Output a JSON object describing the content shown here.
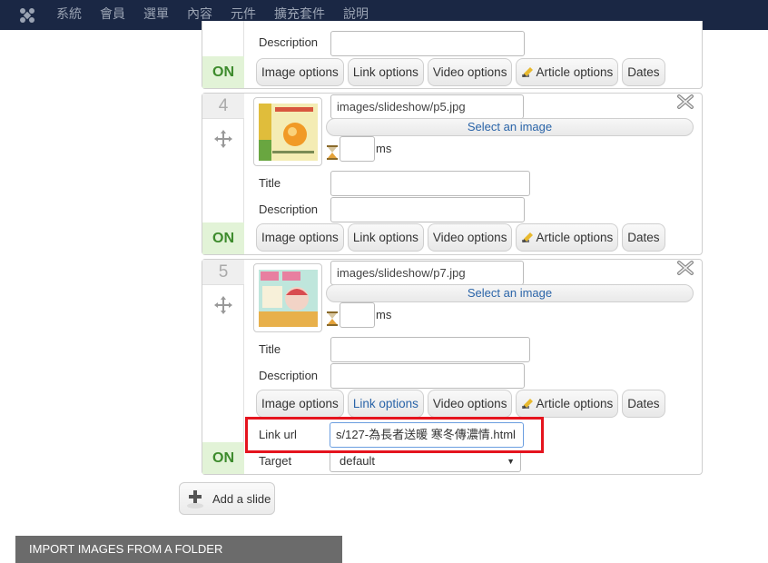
{
  "nav": {
    "items": [
      "系統",
      "會員",
      "選單",
      "內容",
      "元件",
      "擴充套件",
      "說明"
    ]
  },
  "labels": {
    "description": "Description",
    "title": "Title",
    "on": "ON",
    "select_image": "Select an image",
    "ms": "ms",
    "link_url": "Link url",
    "target": "Target"
  },
  "buttons": [
    "Image options",
    "Link options",
    "Video options",
    "Article options",
    "Dates"
  ],
  "slides": [
    {
      "number": "4",
      "image_path": "images/slideshow/p5.jpg"
    },
    {
      "number": "5",
      "image_path": "images/slideshow/p7.jpg"
    }
  ],
  "link": {
    "url": "s/127-為長者送暖 寒冬傳濃情.html",
    "target": "default"
  },
  "add_slide": "Add a slide",
  "import": "IMPORT IMAGES FROM A FOLDER",
  "colors": {
    "nav_bg": "#1a2744",
    "on_green": "#3d8b2c",
    "link_blue": "#2a64a8",
    "highlight_red": "#e5141e"
  }
}
